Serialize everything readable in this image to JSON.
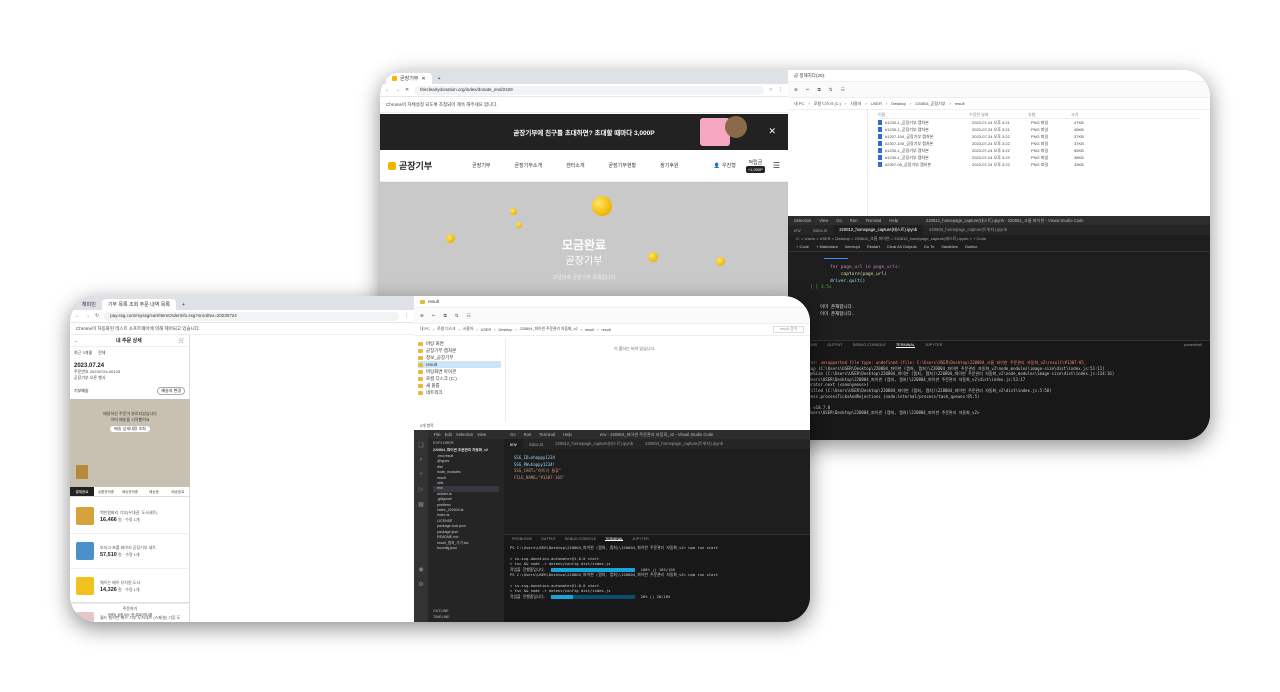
{
  "back_browser": {
    "tab_title": "곧장기부",
    "url": "theclearlydonation.org/index/donate_end/2429",
    "infobar": "Chrome이 자체설정 되도록 조정되어 계속 해주세요 합니다.",
    "banner": "곧장기부에 친구를 초대하면? 초대할 때마다 3,000P",
    "logo": "곧장기부",
    "nav": [
      "곧장기부",
      "곧장기부소개",
      "센터소개",
      "곧장기부현황",
      "정기후원"
    ],
    "user": "우진형",
    "points_label": "적립금",
    "points": "+1,000P",
    "hero_title": "모금완료",
    "hero_sub": "곧장기부",
    "hero_desc": "모금완료 곧장기부 목록입니다"
  },
  "back_explorer": {
    "title": "곧 정해지다(20).",
    "path": [
      "내 PC",
      "로컬 디스크 (C:)",
      "사용자",
      "USER",
      "Desktop",
      "220804_곧장기부",
      "result"
    ],
    "columns": [
      "이름",
      "수정한 날짜",
      "유형",
      "크기"
    ],
    "files": [
      {
        "name": "#1230-1_곧장기부 캡처본",
        "date": "2023-07-24 오후 3:21",
        "type": "PNG 파일",
        "size": "47KB"
      },
      {
        "name": "#1230-1_곧장기부 캡처본",
        "date": "2023-07-24 오후 3:21",
        "type": "PNG 파일",
        "size": "45KB"
      },
      {
        "name": "#1207-104_곧장기부 캡처본",
        "date": "2023-07-24 오후 3:22",
        "type": "PNG 파일",
        "size": "37KB"
      },
      {
        "name": "#2307-100_곧장기부 캡처본",
        "date": "2023-07-24 오후 3:22",
        "type": "PNG 파일",
        "size": "37KB"
      },
      {
        "name": "#1230-1_곧장기부 캡처본",
        "date": "2023-07-24 오후 3:22",
        "type": "PNG 파일",
        "size": "55KB"
      },
      {
        "name": "#1230-1_곧장기부 캡처본",
        "date": "2023-07-24 오후 3:22",
        "type": "PNG 파일",
        "size": "38KB"
      },
      {
        "name": "#2307-05_곧장기부 캡처본",
        "date": "2023-07-24 오후 3:22",
        "type": "PNG 파일",
        "size": "33KB"
      }
    ]
  },
  "back_vscode": {
    "menu": [
      "File",
      "Edit",
      "Selection",
      "View",
      "Go",
      "Run",
      "Terminal",
      "Help"
    ],
    "window_title": "220812_homepage_capture(테스트).ipynb - 220804_크롬 파이썬 - Visual Studio Code",
    "tabs": [
      "env",
      "index.ts",
      "220812_homepage_capture(테스트).ipynb",
      "220804_homepage_capture(트위터).ipynb"
    ],
    "breadcrumb": "C: > Users > USER > Desktop > 220804_크롬 파이썬 > 220812_homepage_capture(테스트).ipynb > + Code",
    "toolbar": [
      "+ Code",
      "+ Markdown",
      "Interrupt",
      "Restart",
      "Clear All Outputs",
      "Go To",
      "Variables",
      "Outline"
    ],
    "code": [
      "for page_url in page_urls:",
      "    capture(page_url)",
      "driver.quit()"
    ],
    "cell_index": "[ ] 3.5s",
    "output": [
      "이미 존재합니다.",
      "이미 존재합니다."
    ],
    "panel_tabs": [
      "PROBLEMS",
      "OUTPUT",
      "DEBUG CONSOLE",
      "TERMINAL",
      "JUPYTER"
    ],
    "shell": "powershell",
    "terminal": [
      "TypeError: unsupported file type: undefined (file: C:\\Users\\USER\\Desktop\\220804_크롬 파이썬 주문관리 자동화_v2\\result\\#1307-05_",
      "    at lookup (C:\\Users\\USER\\Desktop\\220804_파이썬 (캡처, 캡처)\\220804_파이썬 주문관리 자동화_v2\\node_modules\\image-size\\dist\\index.js:51:11)",
      "    at imageSize (C:\\Users\\USER\\Desktop\\220804_파이썬 (캡처, 캡처)\\220804_파이썬 주문관리 자동화_v2\\node_modules\\image-size\\dist\\index.js:114:16)",
      "    at C:\\Users\\USER\\Desktop\\220804_파이썬 (캡처, 캡처)\\220804_파이썬 주문관리 자동화_v2\\dist\\index.js:53:17",
      "    at Generator.next (<anonymous>)",
      "    at fulfilled (C:\\Users\\USER\\Desktop\\220804_파이썬 (캡처, 캡처)\\220804_파이썬 주문관리 자동화_v2\\dist\\index.js:5:58)",
      "    at process.processTicksAndRejections (node:internal/process/task_queues:95:5)",
      "",
      "Node.js v18.7.0",
      "PS C:\\Users\\USER\\Desktop\\220804_파이썬 (캡처, 캡처)\\220804_파이썬 주문관리 자동화_v2>"
    ]
  },
  "front_browser": {
    "tabs": [
      "해피빈",
      "기부 목록 조회 주문 내역 목록",
      "+"
    ],
    "url": "pay.ssg.com/myssg/cart/ItemOrderInfo.ssg?orordNo=20230724",
    "infobar": "Chrome이 자동화된 테스트 소프트웨어에 의해 제어되고 있습니다.",
    "page_title": "내 주문 상세",
    "filter_label": "최근 3개월",
    "filter_value": "전체",
    "date": "2023.07.24",
    "order_no": "주문번호 20230724-00125",
    "order_sub": "곧장기부 오픈 행사",
    "delivery_label": "기부배송",
    "delivery_btn": "배송지 변경",
    "notice": [
      "배달하신 주문이 완료되었습니다",
      "이미 배송을 시작했어요",
      "배송 상세내용 조회"
    ],
    "notice_btn": "배송 상세내용 조회",
    "item_tabs": [
      "결제완료",
      "상품준비중",
      "배송준비중",
      "배송중",
      "배송완료"
    ],
    "products": [
      {
        "name": "백만원짜리 기부(우대권, 도서세트)",
        "price": "16,466",
        "meta": "원 · 수량 1개"
      },
      {
        "name": "보자고 초를 봐야지 곧장기부 세트",
        "price": "57,510",
        "meta": "원 · 수량 1개"
      },
      {
        "name": "웨이는 메이 유치원 도서",
        "price": "14,326",
        "meta": "원 · 수량 1개"
      },
      {
        "name": "월드 필리핀 배우 기부 도서세트 (스페셜) 기증 도서",
        "price": "",
        "meta": ""
      }
    ],
    "footer": "주문하기",
    "footer_sub": "선택된 상품 0개 / 총 결제금액 0원"
  },
  "front_explorer": {
    "title": "result",
    "path": [
      "내 PC",
      "로컬 디스크",
      "사용자",
      "USER",
      "Desktop",
      "220804_파이썬 주문관리 자동화_v2",
      "result",
      "result"
    ],
    "search": "result 검색",
    "folders": [
      "바탕 화면",
      "곧장기부 캡처본",
      "정보_곧장기부",
      "result",
      "바탕화면 아이콘",
      "로컬 디스크 (C:)",
      "새 볼륨",
      "네트워크"
    ],
    "empty": "이 폴더는 비어 있습니다.",
    "status": "0개 항목"
  },
  "front_vscode": {
    "menu": [
      "File",
      "Edit",
      "Selection",
      "View",
      "Go",
      "Run",
      "Terminal",
      "Help"
    ],
    "window_title": "env - 220804_파이썬 주문관리 자동화_v2 - Visual Studio Code",
    "explorer_header": "EXPLORER",
    "project": "220804_파이썬 주문관리 자동화_v2",
    "tree": [
      ".env.result",
      "@types",
      "dist",
      "node_modules",
      "result",
      "utils",
      "env",
      "asfrdm.ts",
      ".gitignore",
      "prettierrc",
      "index_220404.ts",
      "index.ts",
      "LICENSE",
      "package-lock.json",
      "package.json",
      "README.md",
      "result_캡처_가기.tss",
      "tsconfig.json"
    ],
    "outline": "OUTLINE",
    "timeline": "TIMELINE",
    "tabs": [
      "env",
      "index.ts",
      "220812_homepage_capture(테스트).ipynb",
      "220804_homepage_capture(트위터).ipynb"
    ],
    "code": [
      "SSG_ID=nhappy1234",
      "SSG_PW=happy1234!",
      "SSG_CART=\"마트기 물류\"",
      "FILE_NAME=\"#1307-105\""
    ],
    "panel_tabs": [
      "PROBLEMS",
      "OUTPUT",
      "DEBUG CONSOLE",
      "TERMINAL",
      "JUPYTER"
    ],
    "terminal": [
      "PS C:\\Users\\USER\\Desktop\\220804_파이썬 (캡처, 캡처)\\220804_파이썬 주문관리 자동화_v2> npm run start",
      "",
      "> ss-ssg-donation-automater@1.0.0 start",
      "> tsc && node -r dotenv/config dist/index.js"
    ],
    "progress1": "100% || 105/105",
    "progress_label1": "작업을 진행중입니다.",
    "progress1_value": 1.0,
    "after": [
      "PS C:\\Users\\USER\\Desktop\\220804_파이썬 (캡처, 캡처)\\220804_파이썬 주문관리 자동화_v2> npm run start",
      "",
      "> ss-ssg-donation-automater@1.0.0 start",
      "> tsc && node -r dotenv/config dist/index.js"
    ],
    "progress_label2": "작업을 진행중입니다.",
    "progress2": "26% || 28/105",
    "progress2_value": 0.26
  }
}
